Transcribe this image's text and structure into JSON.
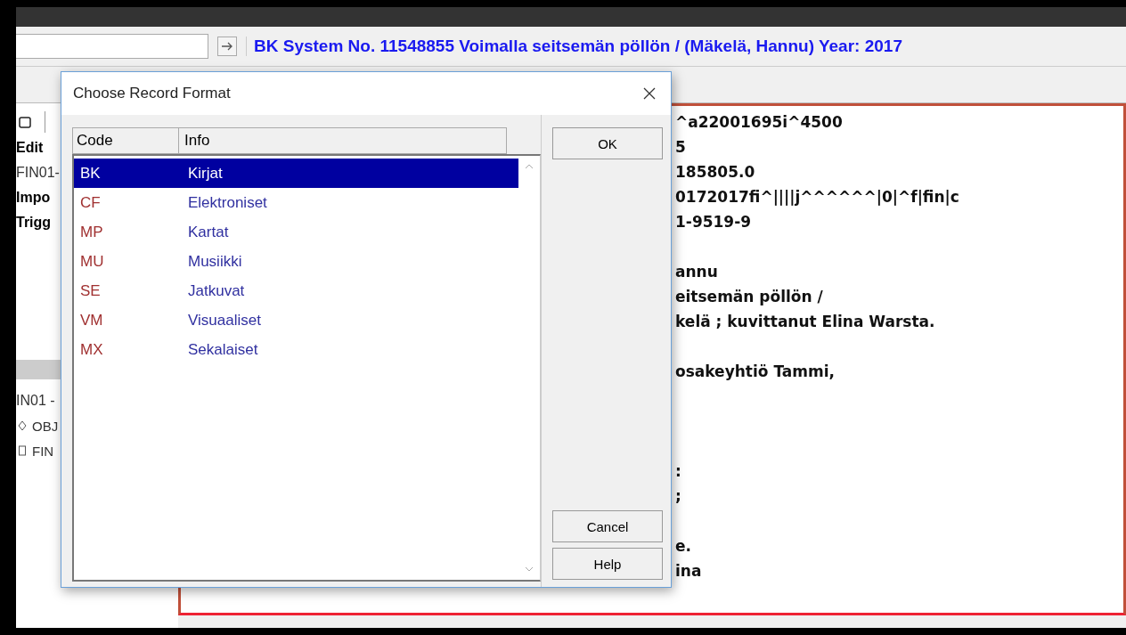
{
  "toolbar": {
    "record_title": "BK System No. 11548855 Voimalla seitsemän pöllön / (Mäkelä, Hannu) Year: 2017"
  },
  "left_panel": {
    "top_items": [
      {
        "text": "Edit",
        "bold": true
      },
      {
        "text": "FIN01-",
        "bold": false
      },
      {
        "text": "Impo",
        "bold": true
      },
      {
        "text": "Trigg",
        "bold": true
      }
    ],
    "tree": {
      "root": "IN01 -",
      "children": [
        {
          "text": "OBJ",
          "kind": "object"
        },
        {
          "text": "FIN",
          "kind": "file"
        }
      ]
    }
  },
  "editor": {
    "blocks": [
      [
        "^a22001695i^4500",
        "5",
        "185805.0",
        "0172017fi^||||j^^^^^^|0|^f|fin|c",
        "1-9519-9"
      ],
      [
        "annu",
        "eitsemän pöllön /",
        "kelä ; kuvittanut Elina Warsta."
      ],
      [
        "osakeyhtiö Tammi,"
      ],
      [
        ":",
        ";"
      ],
      [
        "e.",
        "ina"
      ]
    ]
  },
  "dialog": {
    "title": "Choose Record Format",
    "columns": [
      "Code",
      "Info"
    ],
    "rows": [
      {
        "code": "BK",
        "info": "Kirjat",
        "selected": true
      },
      {
        "code": "CF",
        "info": "Elektroniset",
        "selected": false
      },
      {
        "code": "MP",
        "info": "Kartat",
        "selected": false
      },
      {
        "code": "MU",
        "info": "Musiikki",
        "selected": false
      },
      {
        "code": "SE",
        "info": "Jatkuvat",
        "selected": false
      },
      {
        "code": "VM",
        "info": "Visuaaliset",
        "selected": false
      },
      {
        "code": "MX",
        "info": "Sekalaiset",
        "selected": false
      }
    ],
    "buttons": {
      "ok": "OK",
      "cancel": "Cancel",
      "help": "Help"
    }
  }
}
